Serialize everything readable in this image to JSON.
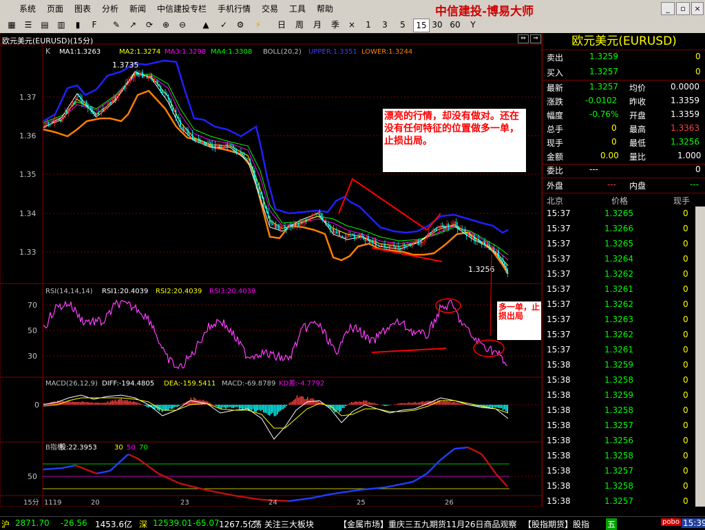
{
  "menu": [
    "系统",
    "页面",
    "图表",
    "分析",
    "新闻",
    "中信建投专栏",
    "手机行情",
    "交易",
    "工具",
    "帮助"
  ],
  "brand": "中信建投-博易大师",
  "window_controls": [
    "_",
    "▫",
    "×"
  ],
  "periods": [
    "日",
    "周",
    "月",
    "季",
    "×",
    "1",
    "3",
    "5",
    "15",
    "30",
    "60",
    "Y"
  ],
  "active_period": "15",
  "chart": {
    "title": "欧元美元(EURUSD)(15分)",
    "header_k": "K",
    "ma1": "MA1:1.3263",
    "ma2": "MA2:1.3274",
    "ma3": "MA3:1.3298",
    "ma4": "MA4:1.3308",
    "boll": "BOLL(20,2)",
    "upper": "UPPER:1.3351",
    "lower": "LOWER:1.3244",
    "high_label": "1.3735",
    "last_label": "1.3256",
    "y_ticks": [
      "1.37",
      "1.36",
      "1.35",
      "1.34",
      "1.33"
    ],
    "annotation": "漂亮的行情，却没有做对。还在没有任何特征的位置做多一单，止损出局。",
    "annotation2": "多一单，止损出局",
    "rsi_header": "RSI(14,14,14)",
    "rsi1": "RSI1:20.4039",
    "rsi2": "RSI2:20.4039",
    "rsi3": "RSI3:20.4039",
    "rsi_ticks": [
      "70",
      "50",
      "30"
    ],
    "macd_header": "MACD(26,12,9)",
    "diff": "DIFF:-194.4805",
    "dea": "DEA:-159.5411",
    "macd": "MACD:-69.8789",
    "kdiff": "KD差:-4.7792",
    "macd_tick": "0",
    "b_header": "B指标",
    "b_val": "股:22.3953",
    "b_30": "30",
    "b_50": "50",
    "b_70": "70",
    "b_tick": "50",
    "period_label": "15分",
    "x_labels": [
      "1119",
      "20",
      "23",
      "24",
      "25",
      "26"
    ]
  },
  "quote": {
    "title": "欧元美元(EURUSD)",
    "sell_label": "卖出",
    "sell": "1.3259",
    "sell_vol": "0",
    "buy_label": "买入",
    "buy": "1.3257",
    "buy_vol": "0",
    "latest_label": "最新",
    "latest": "1.3257",
    "avg_label": "均价",
    "avg": "0.0000",
    "chg_label": "涨跌",
    "chg": "-0.0102",
    "prev_label": "昨收",
    "prev": "1.3359",
    "pct_label": "幅度",
    "pct": "-0.76%",
    "open_label": "开盘",
    "open": "1.3359",
    "total_label": "总手",
    "total": "0",
    "high_label": "最高",
    "high": "1.3363",
    "cur_label": "现手",
    "cur": "0",
    "low_label": "最低",
    "low": "1.3256",
    "amt_label": "金额",
    "amt": "0.00",
    "ratio_label": "量比",
    "ratio": "1.000",
    "wb_label": "委比",
    "wb": "---",
    "wb_val": "0",
    "out_label": "外盘",
    "out": "---",
    "in_label": "内盘",
    "in": "---",
    "col_time": "北京",
    "col_price": "价格",
    "col_vol": "现手",
    "ticks": [
      [
        "15:37",
        "1.3265",
        "0"
      ],
      [
        "15:37",
        "1.3266",
        "0"
      ],
      [
        "15:37",
        "1.3265",
        "0"
      ],
      [
        "15:37",
        "1.3264",
        "0"
      ],
      [
        "15:37",
        "1.3262",
        "0"
      ],
      [
        "15:37",
        "1.3261",
        "0"
      ],
      [
        "15:37",
        "1.3262",
        "0"
      ],
      [
        "15:37",
        "1.3263",
        "0"
      ],
      [
        "15:37",
        "1.3262",
        "0"
      ],
      [
        "15:37",
        "1.3261",
        "0"
      ],
      [
        "15:38",
        "1.3259",
        "0"
      ],
      [
        "15:38",
        "1.3258",
        "0"
      ],
      [
        "15:38",
        "1.3259",
        "0"
      ],
      [
        "15:38",
        "1.3258",
        "0"
      ],
      [
        "15:38",
        "1.3257",
        "0"
      ],
      [
        "15:38",
        "1.3256",
        "0"
      ],
      [
        "15:38",
        "1.3258",
        "0"
      ],
      [
        "15:38",
        "1.3257",
        "0"
      ],
      [
        "15:38",
        "1.3258",
        "0"
      ],
      [
        "15:38",
        "1.3257",
        "0"
      ]
    ]
  },
  "status": {
    "sh": "沪",
    "sh_idx": "2871.70",
    "sh_chg": "-26.56",
    "sh_amt": "1453.6亿",
    "sz": "深",
    "sz_idx": "12539.01",
    "sz_chg": "-65.07",
    "sz_amt": "1267.5亿",
    "news1": "荡 关注三大板块",
    "news2": "【金属市场】重庆三五九期货11月26日商品观察",
    "news3": "【股指期货】股指",
    "tray": "五",
    "tray_badge": "pobo",
    "clock": "15:39"
  }
}
